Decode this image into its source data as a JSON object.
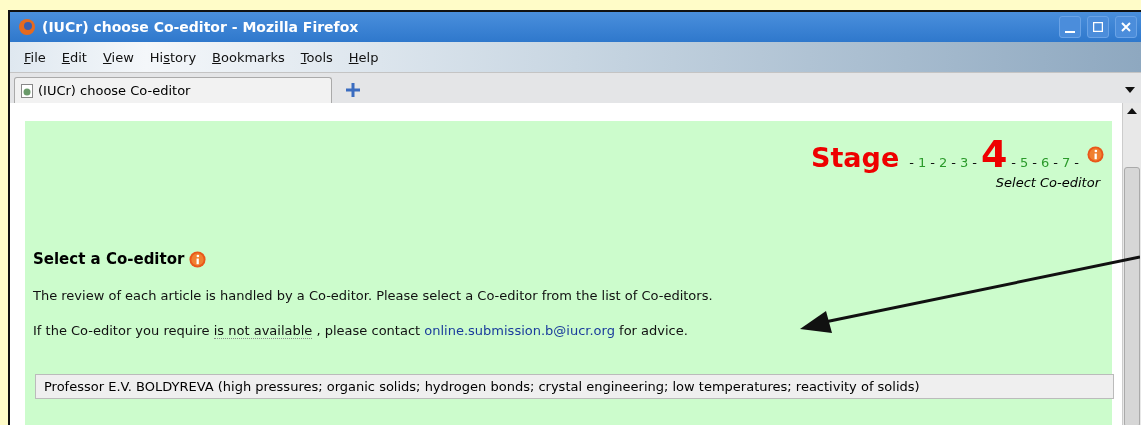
{
  "window": {
    "title": "(IUCr) choose Co-editor - Mozilla Firefox"
  },
  "menu": [
    {
      "key": "F",
      "after": "ile"
    },
    {
      "key": "E",
      "after": "dit"
    },
    {
      "key": "V",
      "after": "iew"
    },
    {
      "before": "Hi",
      "key": "s",
      "after": "tory"
    },
    {
      "key": "B",
      "after": "ookmarks"
    },
    {
      "key": "T",
      "after": "ools"
    },
    {
      "key": "H",
      "after": "elp"
    }
  ],
  "tabs": [
    {
      "label": "(IUCr) choose Co-editor",
      "selected": true
    }
  ],
  "stage": {
    "title": "Stage",
    "separator": "-",
    "subtitle": "Select Co-editor",
    "steps": [
      {
        "label": "1",
        "selected": false
      },
      {
        "label": "2",
        "selected": false
      },
      {
        "label": "3",
        "selected": false
      },
      {
        "label": "4",
        "selected": true
      },
      {
        "label": "5",
        "selected": false
      },
      {
        "label": "6",
        "selected": false
      },
      {
        "label": "7",
        "selected": false
      }
    ]
  },
  "section": {
    "heading": "Select a Co-editor",
    "intro": "The review of each article is handled by a Co-editor. Please select a Co-editor from the list of Co-editors.",
    "contact": {
      "before": "If the Co-editor you require ",
      "term": "is not available",
      "middle": " , please contact ",
      "link": "online.submission.b@iucr.org",
      "after": " for advice."
    },
    "coeditor_select": {
      "value": "Professor E.V. BOLDYREVA (high pressures; organic solids; hydrogen bonds; crystal engineering; low temperatures; reactivity of solids)"
    }
  }
}
